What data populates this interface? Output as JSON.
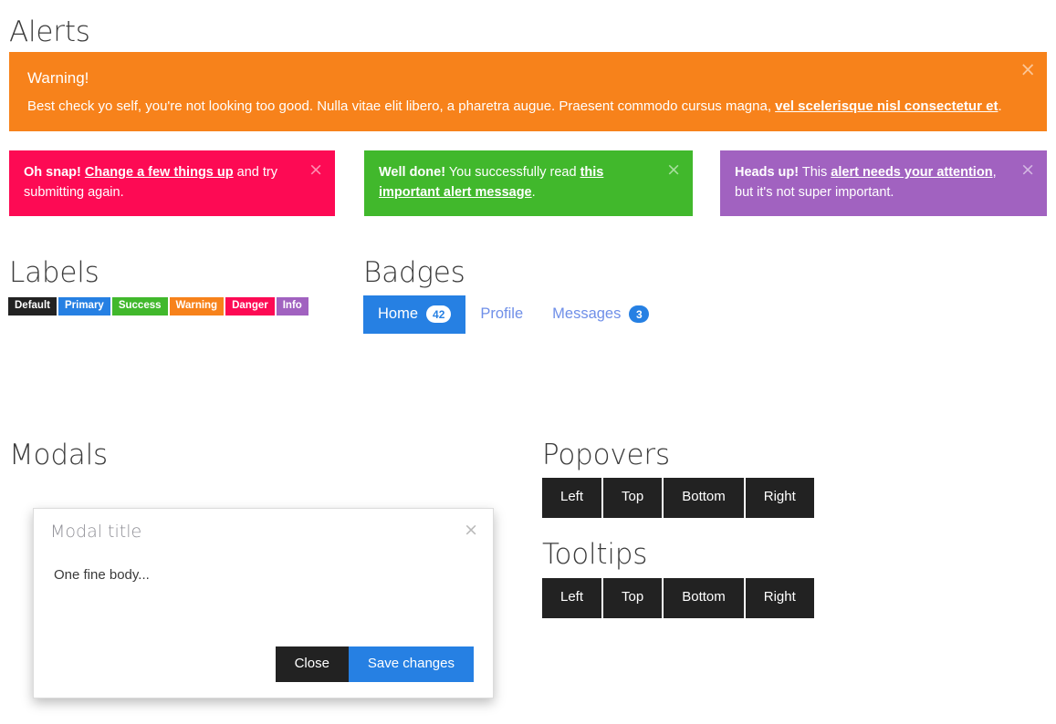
{
  "sections": {
    "alerts_title": "Alerts",
    "labels_title": "Labels",
    "badges_title": "Badges",
    "modals_title": "Modals",
    "popovers_title": "Popovers",
    "tooltips_title": "Tooltips"
  },
  "alerts": {
    "warning": {
      "color": "#f7821b",
      "heading": "Warning!",
      "body_before": "Best check yo self, you're not looking too good. Nulla vitae elit libero, a pharetra augue. Praesent commodo cursus magna, ",
      "body_link": "vel scelerisque nisl consectetur et",
      "body_after": ".",
      "close_icon": "close-icon",
      "close_glyph": "×"
    },
    "danger": {
      "color": "#fd0a54",
      "strong": "Oh snap!",
      "link": "Change a few things up",
      "text_after": " and try submitting again.",
      "close_glyph": "×"
    },
    "success": {
      "color": "#41b82c",
      "strong": "Well done!",
      "text_before": " You successfully read ",
      "link": "this important alert message",
      "text_after": ".",
      "close_glyph": "×"
    },
    "info": {
      "color": "#a162c0",
      "strong": "Heads up!",
      "text_before": " This ",
      "link": "alert needs your attention",
      "text_after": ", but it's not super important.",
      "close_glyph": "×"
    }
  },
  "labels": [
    {
      "text": "Default",
      "color": "#222222"
    },
    {
      "text": "Primary",
      "color": "#2680e3"
    },
    {
      "text": "Success",
      "color": "#41b82c"
    },
    {
      "text": "Warning",
      "color": "#f7821b"
    },
    {
      "text": "Danger",
      "color": "#fd0a54"
    },
    {
      "text": "Info",
      "color": "#a162c0"
    }
  ],
  "badges": [
    {
      "label": "Home",
      "count": "42",
      "active": true
    },
    {
      "label": "Profile",
      "count": "",
      "active": false
    },
    {
      "label": "Messages",
      "count": "3",
      "active": false
    }
  ],
  "modal": {
    "title": "Modal title",
    "body": "One fine body...",
    "close_glyph": "×",
    "close_button": "Close",
    "save_button": "Save changes"
  },
  "popovers": [
    "Left",
    "Top",
    "Bottom",
    "Right"
  ],
  "tooltips": [
    "Left",
    "Top",
    "Bottom",
    "Right"
  ]
}
